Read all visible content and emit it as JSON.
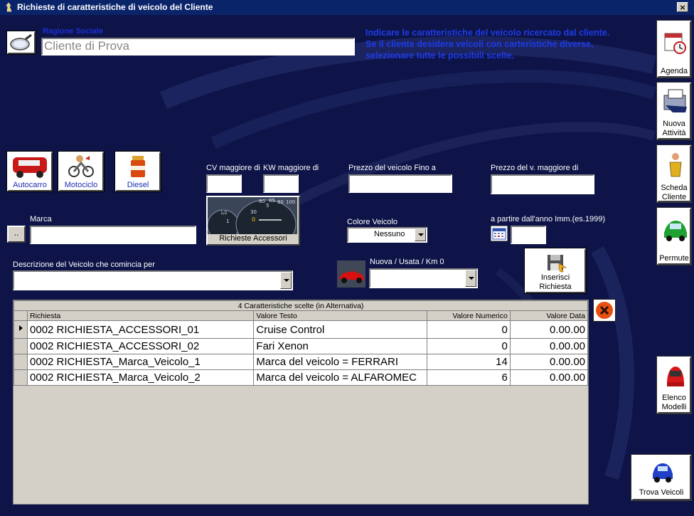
{
  "window": {
    "title": "Richieste di caratteristiche di veicolo del Cliente",
    "close_label": "×"
  },
  "cliente": {
    "label": "Ragione Sociale",
    "value": "Cliente di Prova"
  },
  "instructions": "Indicare le caratteristiche del veicolo ricercato dal cliente. Se il cliente desidera veicoli con carteristiche diverse, selezionare tutte le possibili scelte.",
  "vehicle_types": [
    {
      "label": "Autocarro"
    },
    {
      "label": "Motociclo"
    },
    {
      "label": "Diesel"
    }
  ],
  "fields": {
    "cv_label": "CV  maggiore di",
    "kw_label": "KW maggiore di",
    "prezzo_fino_label": "Prezzo del veicolo Fino a",
    "prezzo_maggiore_label": "Prezzo del v. maggiore di",
    "marca_label": "Marca",
    "marca_browse_label": "..",
    "accessori_label": "Richieste Accessori",
    "colore_label": "Colore Veicolo",
    "colore_value": "Nessuno",
    "anno_label": "a partire dall'anno Imm.(es.1999)",
    "descrizione_label": "Descrizione del Veicolo che comincia per",
    "nuova_usata_label": "Nuova / Usata / Km 0",
    "inserisci_label_1": "Inserisci",
    "inserisci_label_2": "Richiesta"
  },
  "grid": {
    "caption": "4  Caratteristiche scelte    (in Alternativa)",
    "columns": [
      "Richiesta",
      "Valore Testo",
      "Valore Numerico",
      "Valore Data"
    ],
    "rows": [
      {
        "richiesta": "0002 RICHIESTA_ACCESSORI_01",
        "testo": "Cruise Control",
        "numerico": "0",
        "data": "0.00.00"
      },
      {
        "richiesta": "0002 RICHIESTA_ACCESSORI_02",
        "testo": "Fari Xenon",
        "numerico": "0",
        "data": "0.00.00"
      },
      {
        "richiesta": "0002 RICHIESTA_Marca_Veicolo_1",
        "testo": "Marca del veicolo = FERRARI",
        "numerico": "14",
        "data": "0.00.00"
      },
      {
        "richiesta": "0002 RICHIESTA_Marca_Veicolo_2",
        "testo": "Marca del veicolo = ALFAROMEC",
        "numerico": "6",
        "data": "0.00.00"
      }
    ]
  },
  "sidebar": {
    "agenda": "Agenda",
    "nuova_1": "Nuova",
    "nuova_2": "Attività",
    "scheda_1": "Scheda",
    "scheda_2": "Cliente",
    "permute": "Permute",
    "elenco_1": "Elenco",
    "elenco_2": "Modelli",
    "trova": "Trova Veicoli"
  },
  "gauge_labels": [
    "80",
    "85",
    "90",
    "100",
    "30",
    "0",
    "1",
    "1/2",
    "5"
  ],
  "colors": {
    "background": "#0e1448",
    "instruction_text": "#1d3ce8",
    "titlebar": "#0a246a"
  }
}
